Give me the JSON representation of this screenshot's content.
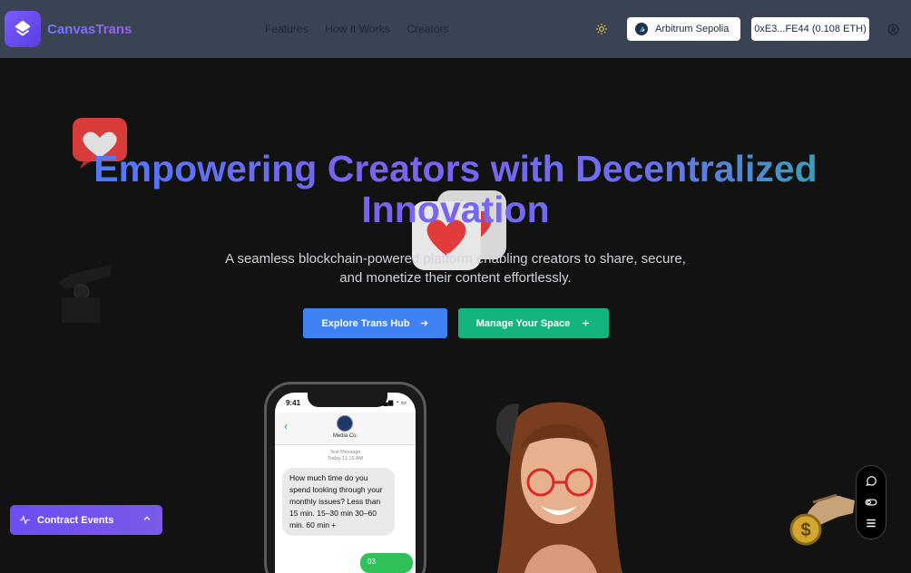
{
  "header": {
    "app_name": "CanvasTrans",
    "logo_icon": "layers-icon",
    "nav": [
      "Features",
      "How It Works",
      "Creators"
    ],
    "theme_icon": "sun-icon",
    "network_label": "Arbitrum Sepolia",
    "network_icon": "arbitrum-icon",
    "wallet_label": "0xE3...FE44 (0.108 ETH)",
    "account_icon": "user-circle-icon"
  },
  "hero": {
    "title": "Empowering Creators with Decentralized Innovation",
    "subtitle": "A seamless blockchain-powered platform enabling creators to share, secure, and monetize their content effortlessly.",
    "primary_cta": "Explore Trans Hub",
    "primary_icon": "arrow-right-icon",
    "secondary_cta": "Manage Your Space",
    "secondary_icon": "plus-icon"
  },
  "phone": {
    "time": "9:41",
    "contact_name": "Media Co.",
    "meta_line1": "Text Message",
    "meta_line2": "Today 11:15 AM",
    "incoming_message": "How much time do you spend looking through your monthly issues? Less than 15 min. 15–30 min 30–60 min. 60 min +",
    "outgoing_message": "03"
  },
  "toolbar": {
    "items": [
      "chat-icon",
      "toggle-icon",
      "menu-icon"
    ]
  },
  "contract_events": {
    "label": "Contract Events",
    "icon": "activity-icon",
    "toggle_icon": "chevron-up-icon"
  },
  "colors": {
    "header_bg": "#3a4354",
    "page_bg": "#121212",
    "primary": "#3f82f4",
    "secondary": "#13b47d",
    "accent": "#6d4df0"
  }
}
